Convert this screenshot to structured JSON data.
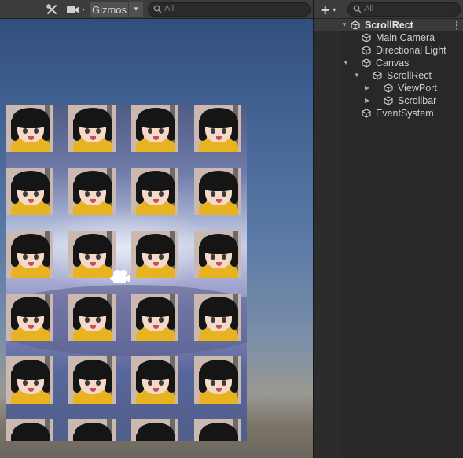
{
  "scene_view": {
    "toolbar": {
      "tools_icon": "wrench-cross-icon",
      "camera_icon": "video-camera-icon",
      "gizmos_label": "Gizmos",
      "dropdown_arrow": "▾",
      "search_placeholder": "All"
    },
    "grid": {
      "rows": 6,
      "columns": 4,
      "tile_icon": "anime-character-portrait"
    },
    "camera_gizmo_icon": "camera-gizmo-icon"
  },
  "hierarchy": {
    "toolbar": {
      "add_label": "+",
      "add_caret": "▾",
      "search_placeholder": "All"
    },
    "scene_name": "ScrollRect",
    "scene_menu": "⋮",
    "items": [
      {
        "label": "Main Camera",
        "depth": 1,
        "expandable": false,
        "expanded": false
      },
      {
        "label": "Directional Light",
        "depth": 1,
        "expandable": false,
        "expanded": false
      },
      {
        "label": "Canvas",
        "depth": 1,
        "expandable": true,
        "expanded": true
      },
      {
        "label": "ScrollRect",
        "depth": 2,
        "expandable": true,
        "expanded": true
      },
      {
        "label": "ViewPort",
        "depth": 3,
        "expandable": true,
        "expanded": false
      },
      {
        "label": "Scrollbar",
        "depth": 3,
        "expandable": true,
        "expanded": false
      },
      {
        "label": "EventSystem",
        "depth": 1,
        "expandable": false,
        "expanded": false
      }
    ]
  },
  "colors": {
    "panel_bg": "#282828",
    "toolbar_bg": "#3c3c3c",
    "selected_scene_bg": "#3a3a3a",
    "shirt_yellow": "#e8b321"
  }
}
